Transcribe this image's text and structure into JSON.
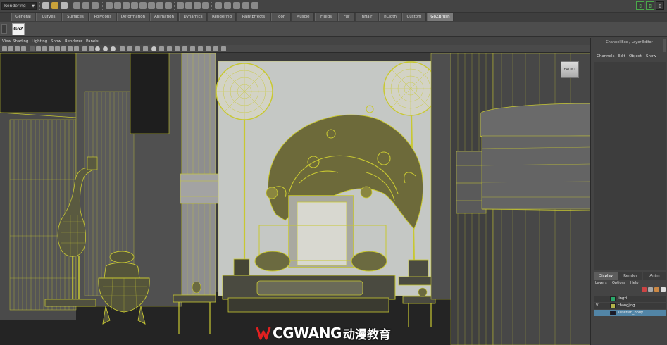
{
  "status_bar": {
    "mode": "Rendering"
  },
  "shelf": {
    "tabs": [
      "General",
      "Curves",
      "Surfaces",
      "Polygons",
      "Deformation",
      "Animation",
      "Dynamics",
      "Rendering",
      "PaintEffects",
      "Toon",
      "Muscle",
      "Fluids",
      "Fur",
      "nHair",
      "nCloth",
      "Custom",
      "GoZBrush"
    ],
    "active_tab": "GoZBrush",
    "gozbrush_button_label": "GoZ"
  },
  "panel_menu": [
    "View",
    "Shading",
    "Lighting",
    "Show",
    "Renderer",
    "Panels"
  ],
  "view_cube_label": "FRONT",
  "watermark": {
    "brand": "CGWANG",
    "chinese": "动漫教育"
  },
  "channel_box": {
    "title": "Channel Box / Layer Editor",
    "menu": [
      "Channels",
      "Edit",
      "Object",
      "Show"
    ]
  },
  "layer_editor": {
    "tabs": [
      "Display",
      "Render",
      "Anim"
    ],
    "active_tab": "Display",
    "menu": [
      "Layers",
      "Options",
      "Help"
    ],
    "layers": [
      {
        "name": "jingzi",
        "visible": "",
        "color": "#2aa86a",
        "selected": false
      },
      {
        "name": "changjing",
        "visible": "V",
        "color": "#b2b24a",
        "selected": false
      },
      {
        "name": "suzetian_body",
        "visible": "",
        "color": "#1a1a2a",
        "selected": true
      }
    ]
  },
  "colors": {
    "wireframe": "#c8c832",
    "selection": "#5285a6"
  }
}
